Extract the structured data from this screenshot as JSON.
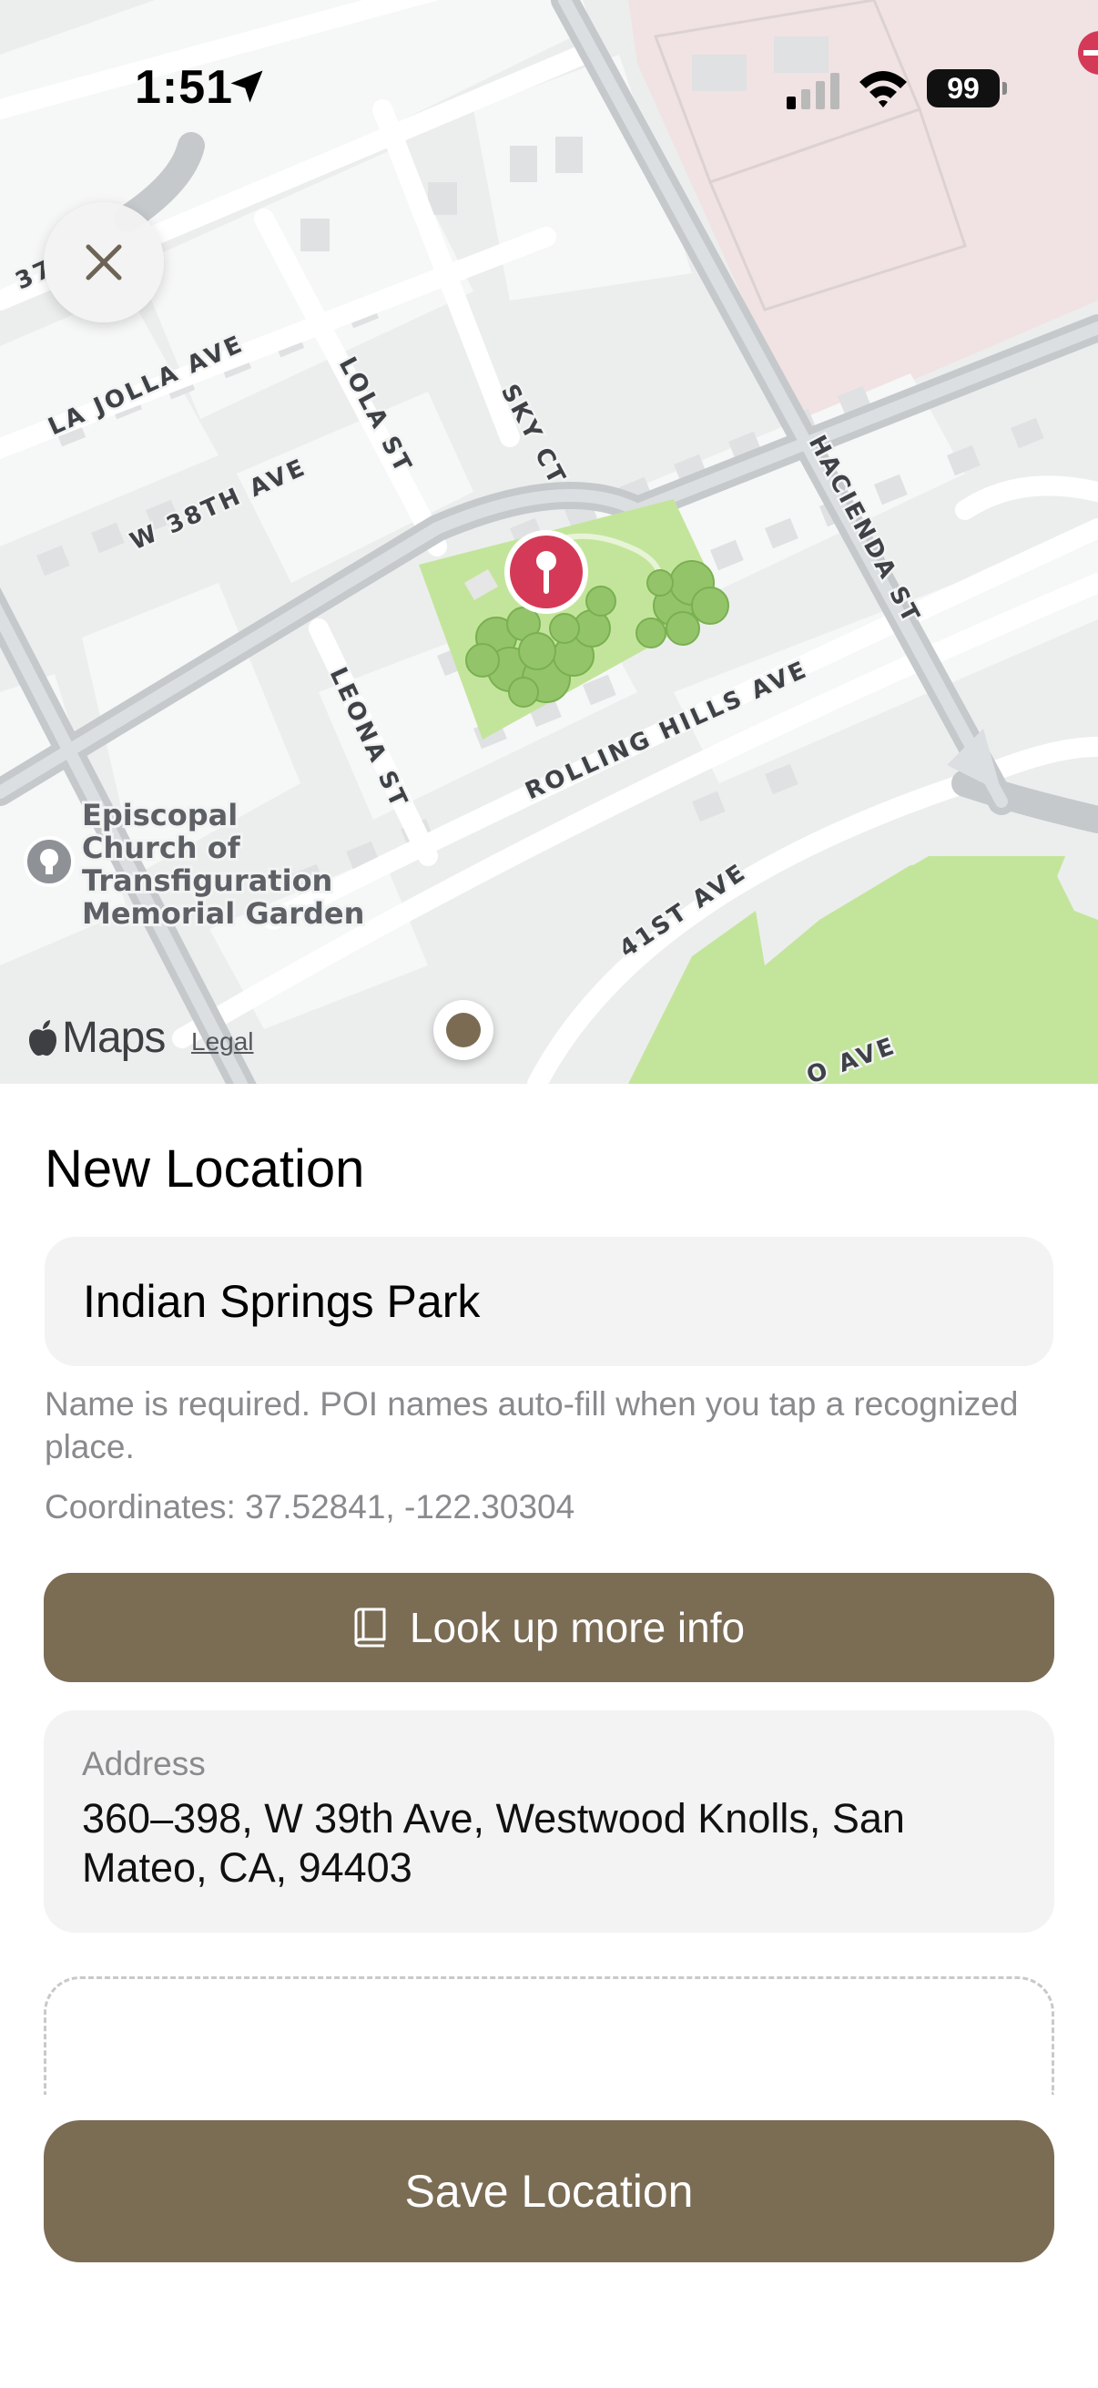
{
  "status_bar": {
    "time": "1:51",
    "battery": "99"
  },
  "map": {
    "street_labels": {
      "la_jolla": "LA JOLLA AVE",
      "w38th": "W 38TH AVE",
      "lola": "LOLA ST",
      "sky": "SKY CT",
      "hacienda": "HACIENDA ST",
      "leona": "LEONA ST",
      "rolling_hills": "ROLLING HILLS AVE",
      "ave41": "41ST AVE",
      "ave_bottom": "O AVE",
      "edge37": "37"
    },
    "poi_label": [
      "Episcopal",
      "Church of",
      "Transfiguration",
      "Memorial Garden"
    ],
    "attribution": "Maps",
    "legal": "Legal",
    "colors": {
      "park": "#c3e59b",
      "pin": "#d43a57",
      "accent": "#7b6c54"
    }
  },
  "sheet": {
    "title": "New Location",
    "name_value": "Indian Springs Park",
    "help_text": "Name is required. POI names auto-fill when you tap a recognized place.",
    "coordinates": "Coordinates: 37.52841, -122.30304",
    "lookup_label": "Look up more info",
    "address_label": "Address",
    "address_value": "360–398, W 39th Ave, Westwood Knolls, San Mateo, CA, 94403",
    "save_label": "Save Location"
  }
}
